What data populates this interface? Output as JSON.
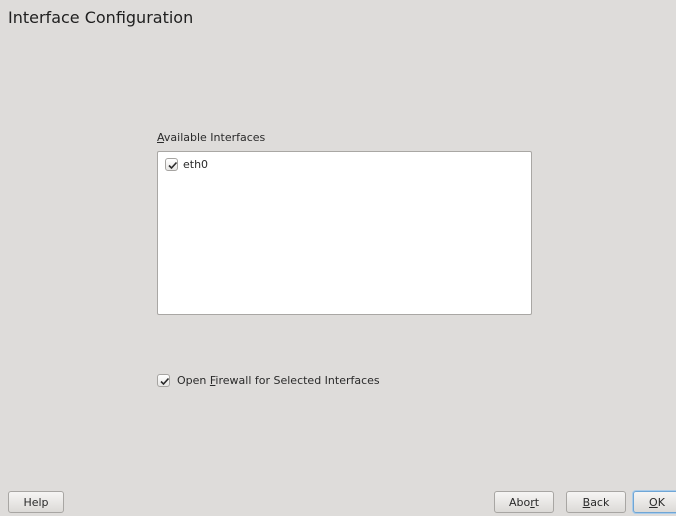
{
  "window": {
    "title": "Interface Configuration"
  },
  "interfaces": {
    "label": "Available Interfaces",
    "label_mnemonic": "A",
    "label_rest": "vailable Interfaces",
    "items": [
      {
        "name": "eth0",
        "checked": true
      }
    ]
  },
  "firewall": {
    "label": "Open Firewall for Selected Interfaces",
    "label_pre": "Open ",
    "label_mnemonic": "F",
    "label_post": "irewall for Selected Interfaces",
    "checked": true
  },
  "buttons": {
    "help": "Help",
    "abort_pre": "Abo",
    "abort_mnemonic": "r",
    "abort_post": "t",
    "back_mnemonic": "B",
    "back_post": "ack",
    "ok_mnemonic": "O",
    "ok_post": "K"
  },
  "colors": {
    "background": "#dedcda",
    "listbox_bg": "#ffffff",
    "focus_border": "#6fa6d6"
  },
  "icons": {
    "check": "checkmark-icon"
  }
}
